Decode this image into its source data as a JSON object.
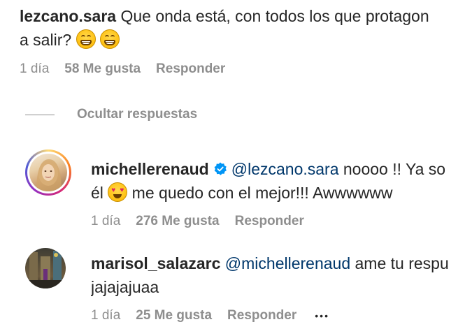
{
  "comment_top": {
    "username": "lezcano.sara",
    "text_line1": "Que onda está, con todos los que protagon",
    "text_line2": "a salir?",
    "emojis": [
      "grinning-face-emoji",
      "grinning-face-emoji"
    ],
    "time": "1 día",
    "likes": "58 Me gusta",
    "reply": "Responder"
  },
  "toggle_replies": {
    "label": "Ocultar respuestas"
  },
  "reply1": {
    "username": "michellerenaud",
    "verified_icon": "verified-badge-icon",
    "mention": "@lezcano.sara",
    "text_line1_rest": " noooo !! Ya so",
    "text_line2_start": "él ",
    "text_line2_end": " me quedo con el mejor!!! Awwwwww",
    "emoji": "smiling-face-with-heart-eyes-emoji",
    "time": "1 día",
    "likes": "276 Me gusta",
    "reply": "Responder",
    "accent": "#0095f6"
  },
  "reply2": {
    "username": "marisol_salazarc",
    "mention": "@michellerenaud",
    "text_line1_rest": " ame tu respu",
    "text_line2": "jajajajuaa",
    "time": "1 día",
    "likes": "25 Me gusta",
    "reply": "Responder",
    "more": "•••"
  },
  "colors": {
    "text": "#262626",
    "muted": "#8e8e8e",
    "mention": "#00376b",
    "verified": "#0095f6"
  }
}
